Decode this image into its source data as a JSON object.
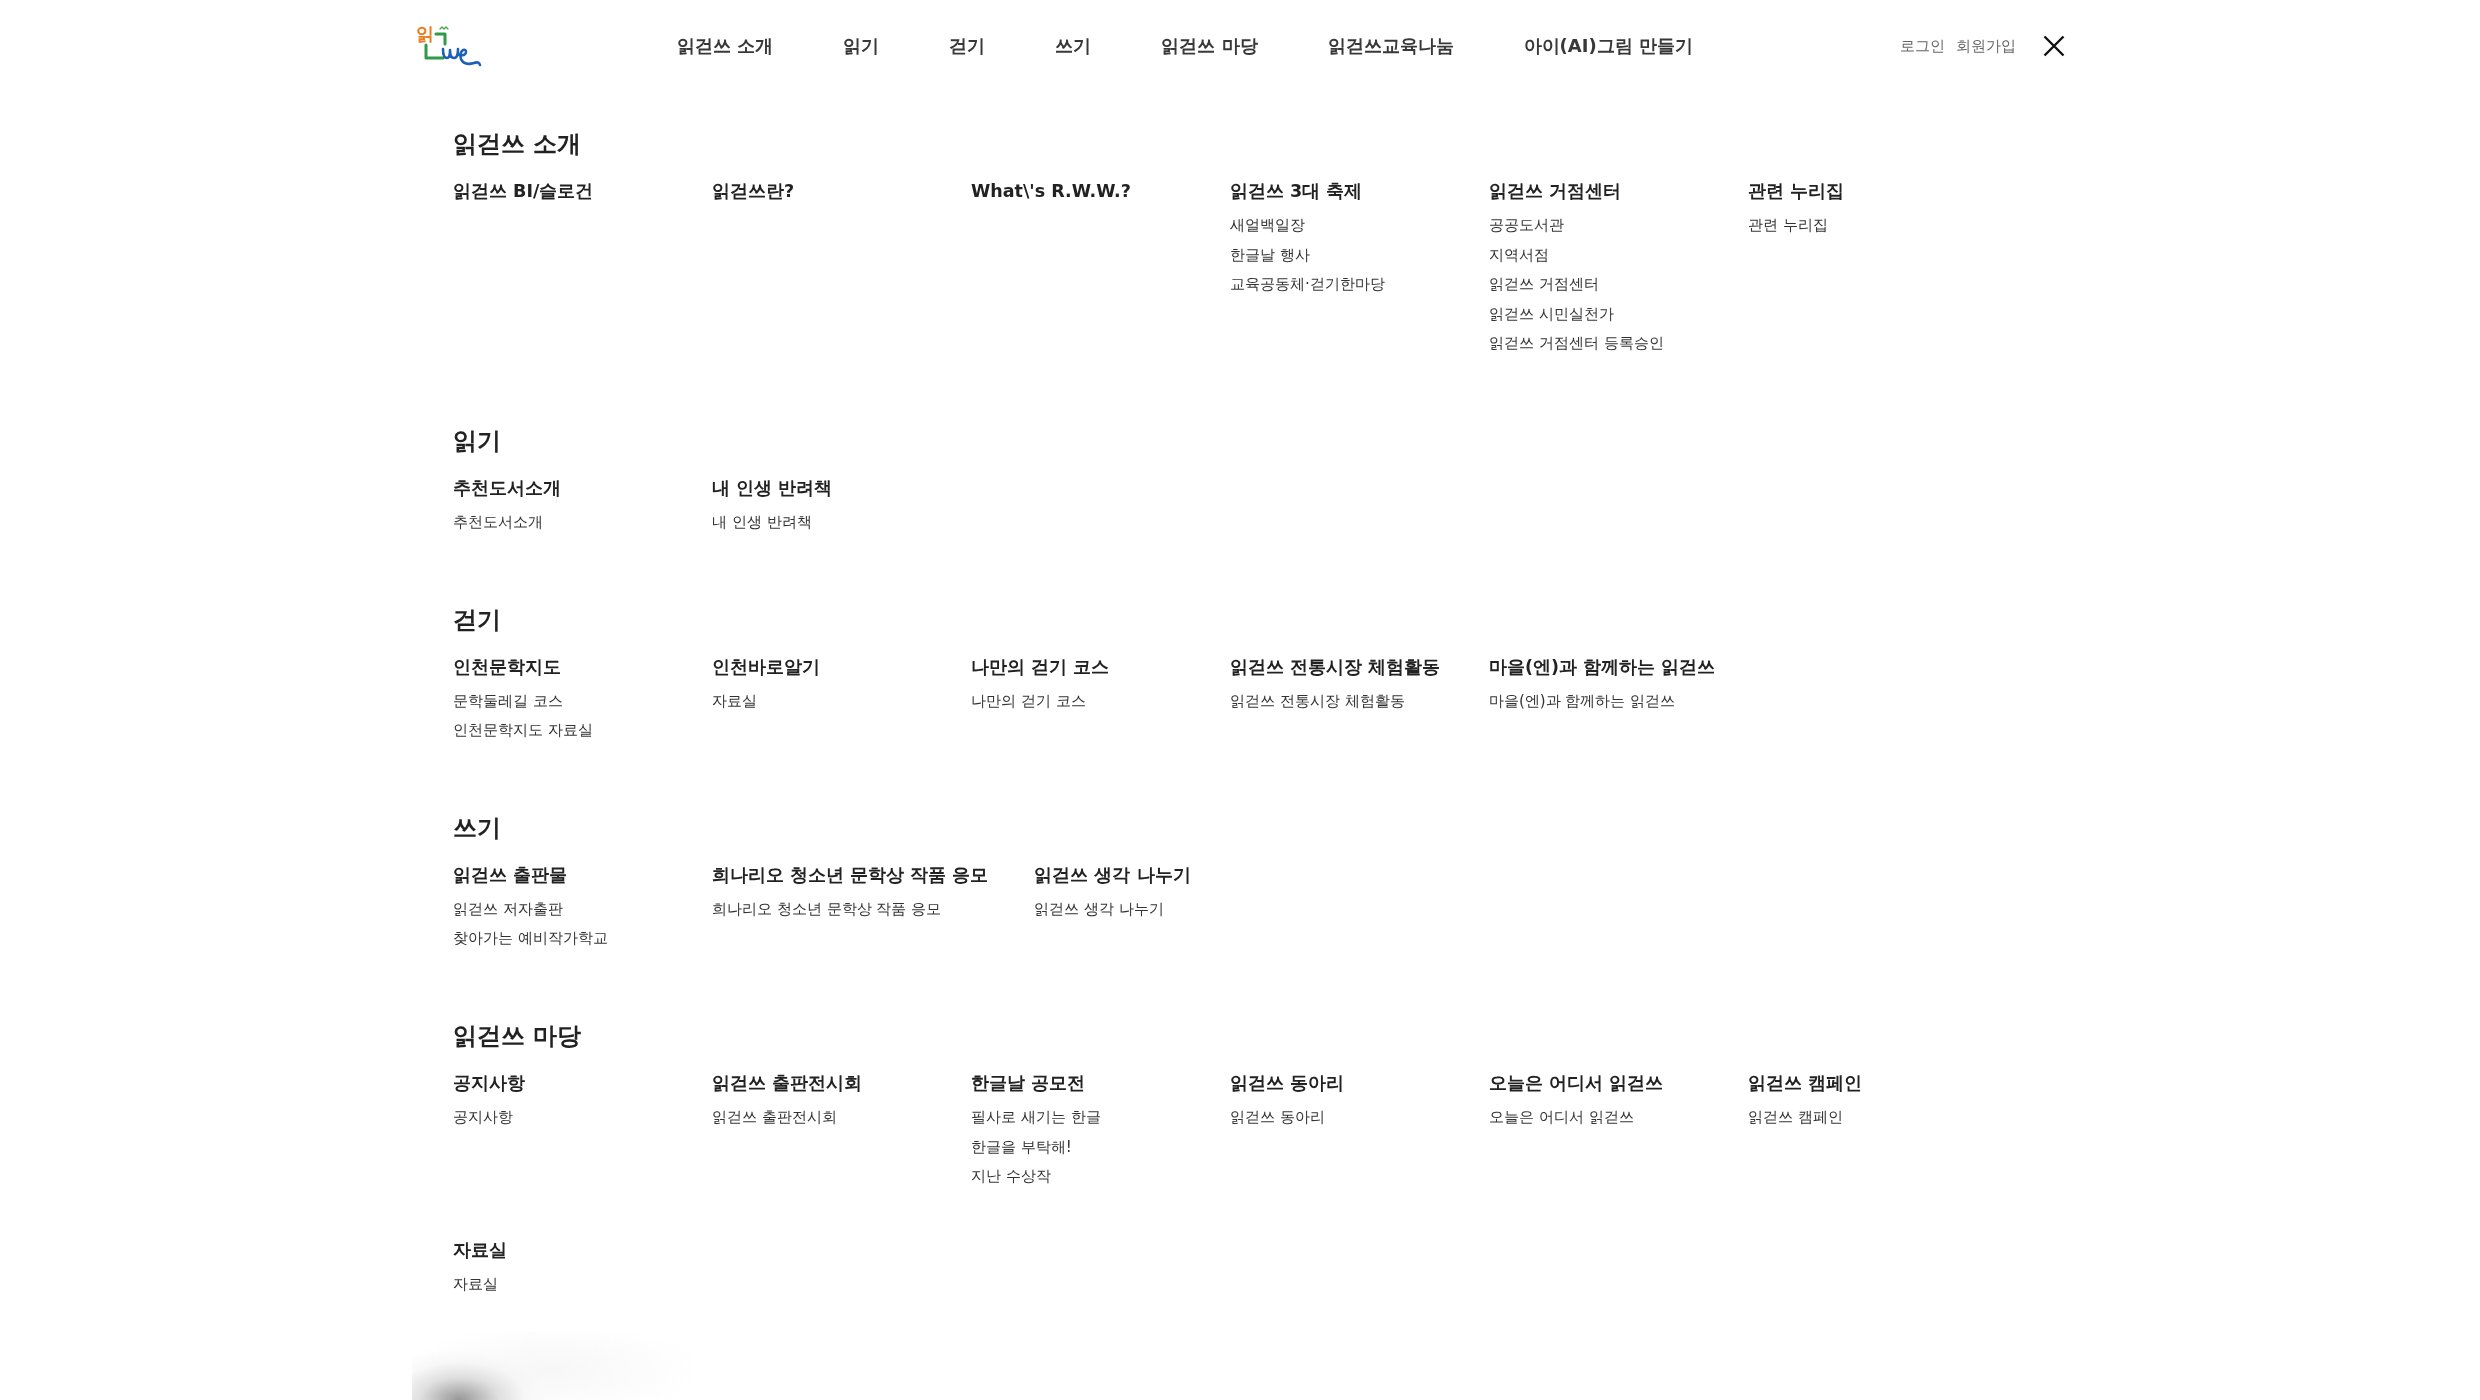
{
  "header": {
    "logo": {
      "text": "읽"
    },
    "nav": [
      "읽걷쓰 소개",
      "읽기",
      "걷기",
      "쓰기",
      "읽걷쓰 마당",
      "읽걷쓰교육나눔",
      "아이(AI)그림 만들기"
    ],
    "account_links": [
      "로그인",
      "회원가입"
    ]
  },
  "sections": [
    {
      "title": "읽걷쓰 소개",
      "groups": [
        {
          "heading": "읽걷쓰 BI/슬로건"
        },
        {
          "heading": "읽걷쓰란?"
        },
        {
          "heading": "What\\'s R.W.W.?"
        },
        {
          "heading": "읽걷쓰 3대 축제",
          "links": [
            "새얼백일장",
            "한글날 행사",
            "교육공동체·걷기한마당"
          ]
        },
        {
          "heading": "읽걷쓰 거점센터",
          "links": [
            "공공도서관",
            "지역서점",
            "읽걷쓰 거점센터",
            "읽걷쓰 시민실천가",
            "읽걷쓰 거점센터 등록승인"
          ]
        },
        {
          "heading": "관련 누리집",
          "links": [
            "관련 누리집"
          ]
        }
      ]
    },
    {
      "title": "읽기",
      "groups": [
        {
          "heading": "추천도서소개",
          "links": [
            "추천도서소개"
          ]
        },
        {
          "heading": "내 인생 반려책",
          "links": [
            "내 인생 반려책"
          ]
        }
      ]
    },
    {
      "title": "걷기",
      "groups": [
        {
          "heading": "인천문학지도",
          "links": [
            "문학둘레길 코스",
            "인천문학지도 자료실"
          ]
        },
        {
          "heading": "인천바로알기",
          "links": [
            "자료실"
          ]
        },
        {
          "heading": "나만의 걷기 코스",
          "links": [
            "나만의 걷기 코스"
          ]
        },
        {
          "heading": "읽걷쓰 전통시장 체험활동",
          "links": [
            "읽걷쓰 전통시장 체험활동"
          ]
        },
        {
          "heading": "마을(엔)과 함께하는 읽걷쓰",
          "links": [
            "마을(엔)과 함께하는 읽걷쓰"
          ]
        }
      ]
    },
    {
      "title": "쓰기",
      "groups": [
        {
          "heading": "읽걷쓰 출판물",
          "links": [
            "읽걷쓰 저자출판",
            "찾아가는 예비작가학교"
          ]
        },
        {
          "heading": "희나리오 청소년 문학상 작품 응모",
          "links": [
            "희나리오 청소년 문학상 작품 응모"
          ]
        },
        {
          "heading": "읽걷쓰 생각 나누기",
          "links": [
            "읽걷쓰 생각 나누기"
          ]
        }
      ]
    },
    {
      "title": "읽걷쓰 마당",
      "groups": [
        {
          "heading": "공지사항",
          "links": [
            "공지사항"
          ]
        },
        {
          "heading": "읽걷쓰 출판전시회",
          "links": [
            "읽걷쓰 출판전시회"
          ]
        },
        {
          "heading": "한글날 공모전",
          "links": [
            "필사로 새기는 한글",
            "한글을 부탁해!",
            "지난 수상작"
          ]
        },
        {
          "heading": "읽걷쓰 동아리",
          "links": [
            "읽걷쓰 동아리"
          ]
        },
        {
          "heading": "오늘은 어디서 읽걷쓰",
          "links": [
            "오늘은 어디서 읽걷쓰"
          ]
        },
        {
          "heading": "읽걷쓰 캠페인",
          "links": [
            "읽걷쓰 캠페인"
          ]
        },
        {
          "heading": "자료실",
          "links": [
            "자료실"
          ]
        }
      ]
    }
  ]
}
